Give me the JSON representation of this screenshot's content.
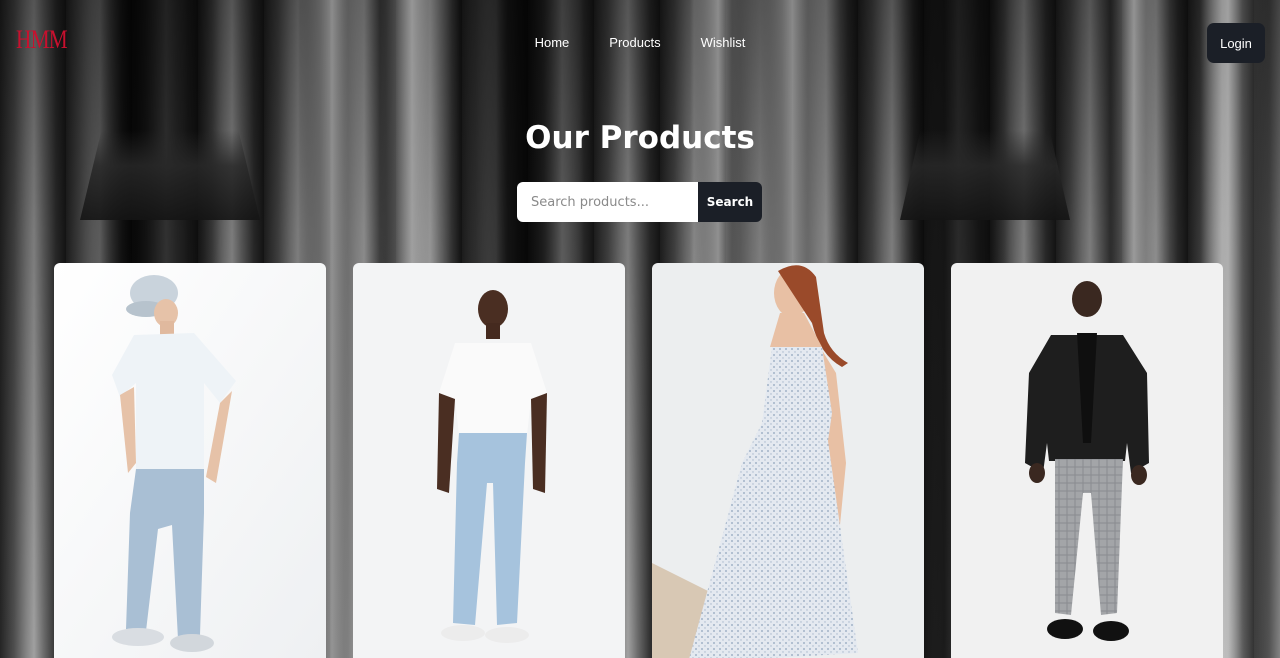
{
  "brand": {
    "logo_text": "HMM",
    "logo_color": "#c8102e"
  },
  "nav": {
    "links": [
      {
        "label": "Home"
      },
      {
        "label": "Products"
      },
      {
        "label": "Wishlist"
      }
    ],
    "login_label": "Login"
  },
  "page": {
    "title": "Our Products"
  },
  "search": {
    "placeholder": "Search products...",
    "button_label": "Search"
  },
  "products": [
    {
      "image": "man in light blue cap, white t-shirt and light blue joggers"
    },
    {
      "image": "man in white t-shirt and light wash jeans"
    },
    {
      "image": "woman in light floral strappy midi dress"
    },
    {
      "image": "man in black leather jacket and grey check trousers"
    }
  ],
  "colors": {
    "accent_dark": "#1b1f27",
    "text_light": "#ffffff"
  }
}
